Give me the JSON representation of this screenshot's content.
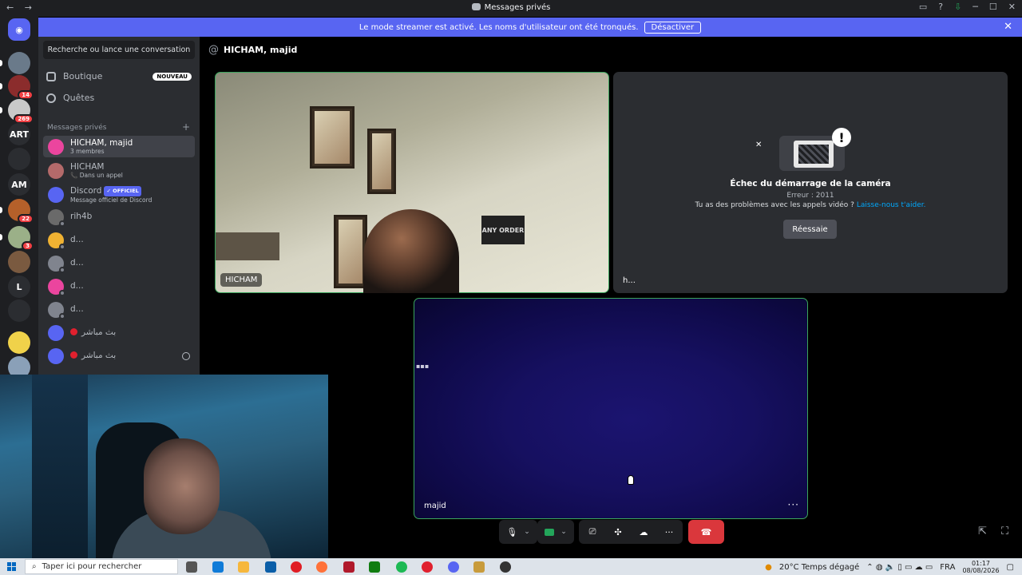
{
  "window": {
    "title": "Messages privés",
    "nav_back": "←",
    "nav_forward": "→",
    "inbox_icon": "▭",
    "help_icon": "?",
    "download_icon": "⇩",
    "minimize": "─",
    "maximize": "☐",
    "close": "✕"
  },
  "banner": {
    "text": "Le mode streamer est activé. Les noms d'utilisateur ont été tronqués.",
    "button": "Désactiver",
    "close": "✕"
  },
  "servers": [
    {
      "label": "",
      "badge": ""
    },
    {
      "label": "",
      "badge": ""
    },
    {
      "label": "",
      "badge": "14"
    },
    {
      "label": "",
      "badge": "269"
    },
    {
      "label": "ART",
      "badge": ""
    },
    {
      "label": "",
      "badge": ""
    },
    {
      "label": "AM",
      "badge": ""
    },
    {
      "label": "",
      "badge": "22"
    },
    {
      "label": "",
      "badge": "3"
    },
    {
      "label": "",
      "badge": ""
    },
    {
      "label": "L",
      "badge": ""
    },
    {
      "label": "",
      "badge": ""
    },
    {
      "label": "",
      "badge": ""
    },
    {
      "label": "",
      "badge": ""
    }
  ],
  "sidebar": {
    "search_placeholder": "Recherche ou lance une conversation",
    "boutique": "Boutique",
    "nouveau": "NOUVEAU",
    "quetes": "Quêtes",
    "section_title": "Messages privés",
    "add": "+",
    "dms": [
      {
        "name": "HICHAM, majid",
        "sub": "3 membres",
        "color": "#eb459e"
      },
      {
        "name": "HICHAM",
        "sub": "📞 Dans un appel",
        "color": "#b46a6a"
      },
      {
        "name": "Discord",
        "sub": "Message officiel de Discord",
        "color": "#5865f2",
        "tag": "✓ OFFICIEL"
      },
      {
        "name": "rih4b",
        "sub": "",
        "color": "#6a6a6a"
      },
      {
        "name": "d...",
        "sub": "",
        "color": "#f0b232"
      },
      {
        "name": "d...",
        "sub": "",
        "color": "#80848e"
      },
      {
        "name": "d...",
        "sub": "",
        "color": "#eb459e"
      },
      {
        "name": "d...",
        "sub": "",
        "color": "#80848e"
      },
      {
        "name": "بث مباشر",
        "sub": "",
        "color": "#5865f2"
      },
      {
        "name": "بث مباشر",
        "sub": "",
        "color": "#5865f2"
      }
    ]
  },
  "header": {
    "at": "@",
    "name": "HICHAM, majid"
  },
  "tiles": {
    "hicham_label": "HICHAM",
    "sign_text": "ANY ORDER",
    "error_label": "h...",
    "error_title": "Échec du démarrage de la caméra",
    "error_code": "Erreur : 2011",
    "error_help": "Tu as des problèmes avec les appels vidéo ?",
    "error_link": "Laisse-nous t'aider.",
    "retry": "Réessaie",
    "majid_label": "majid",
    "more": "···"
  },
  "controls": {
    "mic": "🎙",
    "chevron": "⌄",
    "screen": "⎚",
    "apps": "✣",
    "soundboard": "☁",
    "more": "···",
    "leave": "☎"
  },
  "taskbar": {
    "search_placeholder": "Taper ici pour rechercher",
    "weather": "20°C  Temps dégagé",
    "language": "FRA",
    "time": "01:17",
    "date": "08/08/2026",
    "app_colors": [
      "#555",
      "#0f7bd8",
      "#f6b73c",
      "#0a5ea8",
      "#e01d24",
      "#ff7139",
      "#b0192b",
      "#107c10",
      "#1db954",
      "#e0202e",
      "#5865f2",
      "#c89b3c",
      "#333"
    ]
  }
}
